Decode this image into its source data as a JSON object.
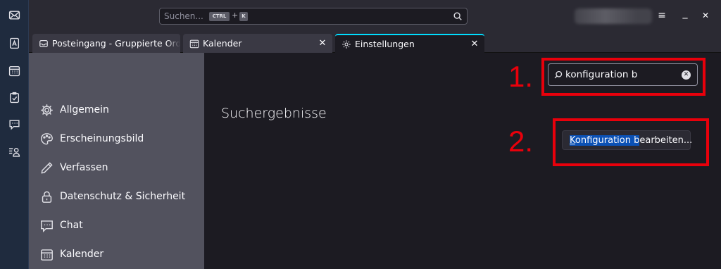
{
  "search": {
    "placeholder": "Suchen...",
    "kbd_ctrl": "CTRL",
    "kbd_plus": "+",
    "kbd_key": "K"
  },
  "spaces": [
    {
      "icon": "mail-icon"
    },
    {
      "icon": "address-book-icon"
    },
    {
      "icon": "calendar-icon"
    },
    {
      "icon": "tasks-icon"
    },
    {
      "icon": "chat-icon"
    },
    {
      "icon": "settings-user-icon"
    }
  ],
  "window": {
    "menu": "≡",
    "minimize": "_",
    "close": "✕"
  },
  "tabs": [
    {
      "label": "Posteingang - Gruppierte Ordner",
      "icon": "inbox-icon"
    },
    {
      "label": "Kalender",
      "icon": "calendar-icon",
      "close": "✕"
    },
    {
      "label": "Einstellungen",
      "icon": "gear-icon",
      "close": "✕"
    }
  ],
  "nav": [
    {
      "label": "Allgemein",
      "icon": "gear-icon"
    },
    {
      "label": "Erscheinungsbild",
      "icon": "palette-icon"
    },
    {
      "label": "Verfassen",
      "icon": "pencil-icon"
    },
    {
      "label": "Datenschutz & Sicherheit",
      "icon": "lock-icon"
    },
    {
      "label": "Chat",
      "icon": "chat-icon"
    },
    {
      "label": "Kalender",
      "icon": "calendar-icon"
    }
  ],
  "content": {
    "heading": "Suchergebnisse",
    "filter_value": "konfiguration b",
    "config_button_match_first": "K",
    "config_button_match_rest": "onfiguration b",
    "config_button_rest": "earbeiten..."
  },
  "annotations": {
    "one": "1.",
    "two": "2."
  },
  "colors": {
    "accent": "#00ddff",
    "annotation_red": "#e8000b",
    "selection": "#0b51b5"
  }
}
